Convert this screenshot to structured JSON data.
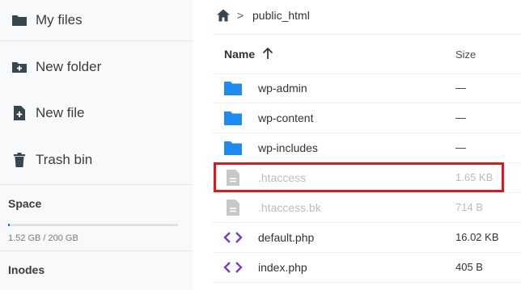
{
  "sidebar": {
    "items": [
      {
        "label": "My files",
        "icon": "folder-icon"
      },
      {
        "label": "New folder",
        "icon": "folder-plus-icon"
      },
      {
        "label": "New file",
        "icon": "file-plus-icon"
      },
      {
        "label": "Trash bin",
        "icon": "trash-icon"
      }
    ],
    "space": {
      "title": "Space",
      "usage": "1.52 GB / 200 GB",
      "used_fraction": 0.0076
    },
    "inodes": {
      "title": "Inodes"
    }
  },
  "breadcrumb": {
    "separator": ">",
    "path": "public_html"
  },
  "table": {
    "columns": {
      "name": "Name",
      "size": "Size",
      "sort": "ascending"
    },
    "rows": [
      {
        "name": "wp-admin",
        "size": "—",
        "type": "folder"
      },
      {
        "name": "wp-content",
        "size": "—",
        "type": "folder"
      },
      {
        "name": "wp-includes",
        "size": "—",
        "type": "folder"
      },
      {
        "name": ".htaccess",
        "size": "1.65 KB",
        "type": "file",
        "dimmed": true,
        "highlighted": true
      },
      {
        "name": ".htaccess.bk",
        "size": "714 B",
        "type": "file",
        "dimmed": true
      },
      {
        "name": "default.php",
        "size": "16.02 KB",
        "type": "code"
      },
      {
        "name": "index.php",
        "size": "405 B",
        "type": "code"
      }
    ]
  },
  "colors": {
    "folder": "#1d8cf2",
    "code": "#7a3db8",
    "file_dim": "#c8c8c8",
    "highlight": "#e4141c",
    "sidebar_bg": "#f8f9fa",
    "icon_dark": "#37474f"
  }
}
